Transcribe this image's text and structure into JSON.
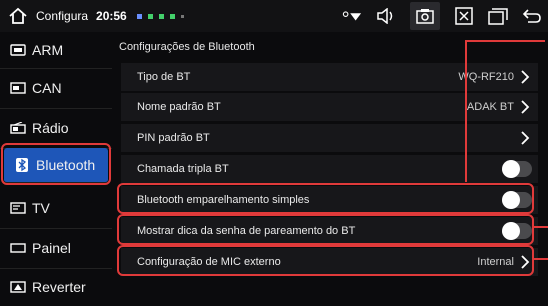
{
  "statusbar": {
    "title": "Configura",
    "time": "20:56"
  },
  "sidebar": {
    "items": [
      {
        "label": "ARM",
        "icon": "chip-icon"
      },
      {
        "label": "CAN",
        "icon": "can-icon"
      },
      {
        "label": "Rádio",
        "icon": "radio-icon"
      },
      {
        "label": "Bluetooth",
        "icon": "bluetooth-icon",
        "active": true
      },
      {
        "label": "TV",
        "icon": "tv-icon"
      },
      {
        "label": "Painel",
        "icon": "panel-icon"
      },
      {
        "label": "Reverter",
        "icon": "reverse-icon"
      }
    ]
  },
  "main": {
    "section_title": "Configurações de Bluetooth",
    "rows": [
      {
        "label": "Tipo de BT",
        "value": "WQ-RF210",
        "control": "chevron"
      },
      {
        "label": "Nome padrão BT",
        "value": "ADAK BT",
        "control": "chevron"
      },
      {
        "label": "PIN padrão BT",
        "value": "",
        "control": "chevron"
      },
      {
        "label": "Chamada tripla BT",
        "value": "",
        "control": "toggle",
        "on": false
      },
      {
        "label": "Bluetooth emparelhamento simples",
        "value": "",
        "control": "toggle",
        "on": false
      },
      {
        "label": "Mostrar dica da senha de pareamento do BT",
        "value": "",
        "control": "toggle",
        "on": false
      },
      {
        "label": "Configuração de MIC externo",
        "value": "Internal",
        "control": "chevron"
      }
    ]
  },
  "colors": {
    "accent": "#1e56b8",
    "highlight": "#e03a3a"
  }
}
